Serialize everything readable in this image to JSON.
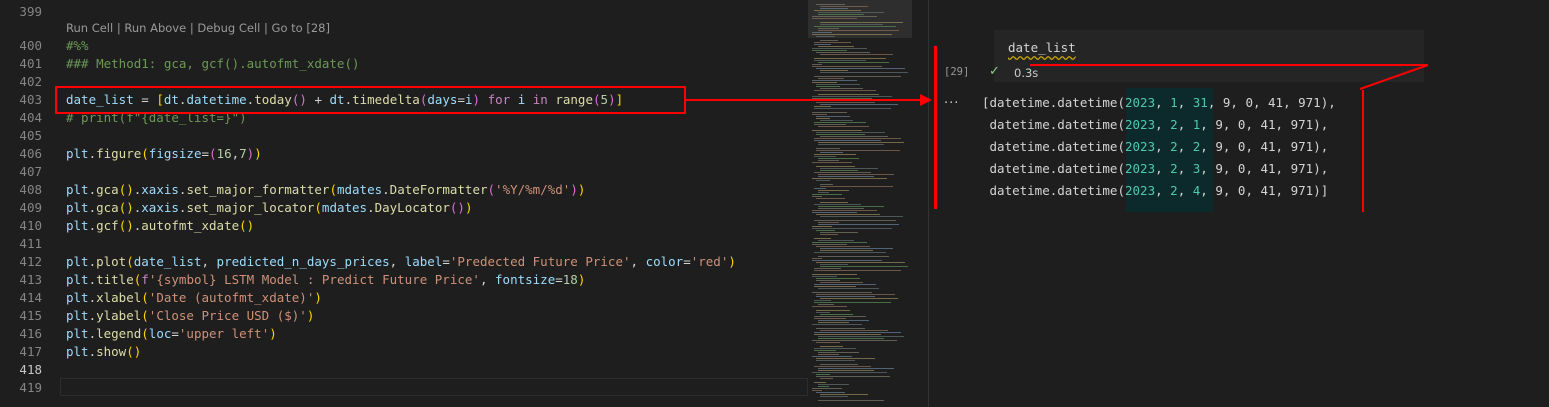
{
  "colors": {
    "background": "#1e1e1e",
    "annotation": "#ff0000",
    "success_check": "#89d185",
    "keyword": "#c586c0",
    "function": "#dcdcaa",
    "string": "#ce9178",
    "number": "#b5cea8",
    "comment": "#6a9955"
  },
  "editor": {
    "line_numbers": [
      "399",
      "400",
      "401",
      "402",
      "403",
      "404",
      "405",
      "406",
      "407",
      "408",
      "409",
      "410",
      "411",
      "412",
      "413",
      "414",
      "415",
      "416",
      "417",
      "418",
      "419"
    ],
    "codelens": {
      "run_cell": "Run Cell",
      "sep1": " | ",
      "run_above": "Run Above",
      "sep2": " | ",
      "debug_cell": "Debug Cell",
      "sep3": " | ",
      "goto": "Go to [28]"
    },
    "lines": [
      "#%%",
      "### Method1: gca, gcf().autofmt_xdate()",
      "",
      "date_list = [dt.datetime.today() + dt.timedelta(days=i) for i in range(5)]",
      "# print(f\"{date_list=}\")",
      "",
      "plt.figure(figsize=(16,7))",
      "",
      "plt.gca().xaxis.set_major_formatter(mdates.DateFormatter('%Y/%m/%d'))",
      "plt.gca().xaxis.set_major_locator(mdates.DayLocator())",
      "plt.gcf().autofmt_xdate()",
      "",
      "plt.plot(date_list, predicted_n_days_prices, label='Predected Future Price', color='red')",
      "plt.title(f'{symbol} LSTM Model : Predict Future Price', fontsize=18)",
      "plt.xlabel('Date (autofmt_xdate)')",
      "plt.ylabel('Close Price USD ($)')",
      "plt.legend(loc='upper left')",
      "plt.show()",
      ""
    ]
  },
  "notebook": {
    "cell_source": "date_list",
    "execution_count": "[29]",
    "status_icon": "check-icon",
    "elapsed": "0.3s",
    "output_menu": "...",
    "output": {
      "prefix_first": "[datetime.datetime(",
      "prefix": " datetime.datetime(",
      "rows": [
        {
          "year": "2023",
          "month": "1",
          "day": "31",
          "rest": "9, 0, 41, 971",
          "end": "),"
        },
        {
          "year": "2023",
          "month": "2",
          "day": "1",
          "rest": "9, 0, 41, 971",
          "end": "),"
        },
        {
          "year": "2023",
          "month": "2",
          "day": "2",
          "rest": "9, 0, 41, 971",
          "end": "),"
        },
        {
          "year": "2023",
          "month": "2",
          "day": "3",
          "rest": "9, 0, 41, 971",
          "end": "),"
        },
        {
          "year": "2023",
          "month": "2",
          "day": "4",
          "rest": "9, 0, 41, 971",
          "end": ")]"
        }
      ]
    }
  }
}
